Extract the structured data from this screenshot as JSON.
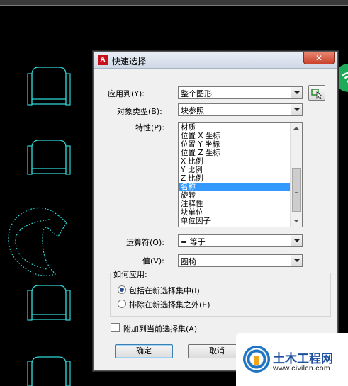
{
  "dialog": {
    "title": "快速选择",
    "app_icon_label": "A",
    "close_label": "✕",
    "apply_to": {
      "label": "应用到(Y):",
      "value": "整个图形"
    },
    "object_type": {
      "label": "对象类型(B):",
      "value": "块参照"
    },
    "properties": {
      "label": "特性(P):",
      "items": [
        "材质",
        "位置 X 坐标",
        "位置 Y 坐标",
        "位置 Z 坐标",
        "X 比例",
        "Y 比例",
        "Z 比例",
        "名称",
        "旋转",
        "注释性",
        "块单位",
        "单位因子"
      ],
      "selected_index": 7
    },
    "operator": {
      "label": "运算符(O):",
      "value": "= 等于"
    },
    "value": {
      "label": "值(V):",
      "value": "圈椅"
    },
    "how_to_apply": {
      "label": "如何应用:",
      "include": "包括在新选择集中(I)",
      "exclude": "排除在新选择集之外(E)",
      "selected": "include"
    },
    "append_label": "附加到当前选择集(A)",
    "ok_label": "确定",
    "cancel_label": "取消"
  },
  "watermark": {
    "name": "土木工程网",
    "url": "www.civilcn.com"
  },
  "colors": {
    "cad_lines": "#2fd6d6",
    "selection": "#3399ff",
    "brand_blue": "#1d4fa0",
    "brand_orange": "#f2a51a"
  }
}
